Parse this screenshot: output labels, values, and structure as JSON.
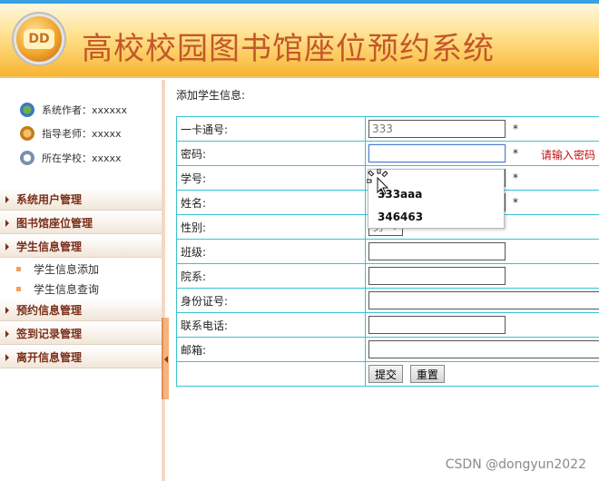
{
  "header": {
    "title": "高校校园图书馆座位预约系统",
    "logo_text": "DD"
  },
  "sidebar": {
    "info": [
      {
        "label": "系统作者：xxxxxx"
      },
      {
        "label": "指导老师：xxxxx"
      },
      {
        "label": "所在学校：xxxxx"
      }
    ],
    "menu": [
      {
        "label": "系统用户管理"
      },
      {
        "label": "图书馆座位管理"
      },
      {
        "label": "学生信息管理"
      },
      {
        "label": "预约信息管理"
      },
      {
        "label": "签到记录管理"
      },
      {
        "label": "离开信息管理"
      }
    ],
    "sub_items": [
      {
        "label": "学生信息添加"
      },
      {
        "label": "学生信息查询"
      }
    ]
  },
  "form": {
    "heading": "添加学生信息:",
    "rows": [
      {
        "label": "一卡通号:",
        "value": "333",
        "required": "*"
      },
      {
        "label": "密码:",
        "value": "",
        "required": "*",
        "error": "请输入密码"
      },
      {
        "label": "学号:",
        "value": "",
        "required": "*"
      },
      {
        "label": "姓名:",
        "value": "",
        "required": "*"
      },
      {
        "label": "性别:",
        "value": "男"
      },
      {
        "label": "班级:",
        "value": ""
      },
      {
        "label": "院系:",
        "value": ""
      },
      {
        "label": "身份证号:",
        "value": ""
      },
      {
        "label": "联系电话:",
        "value": ""
      },
      {
        "label": "邮箱:",
        "value": ""
      }
    ],
    "submit_label": "提交",
    "reset_label": "重置"
  },
  "autocomplete": {
    "options": [
      "333aaa",
      "346463"
    ]
  },
  "watermark": "CSDN @dongyun2022"
}
